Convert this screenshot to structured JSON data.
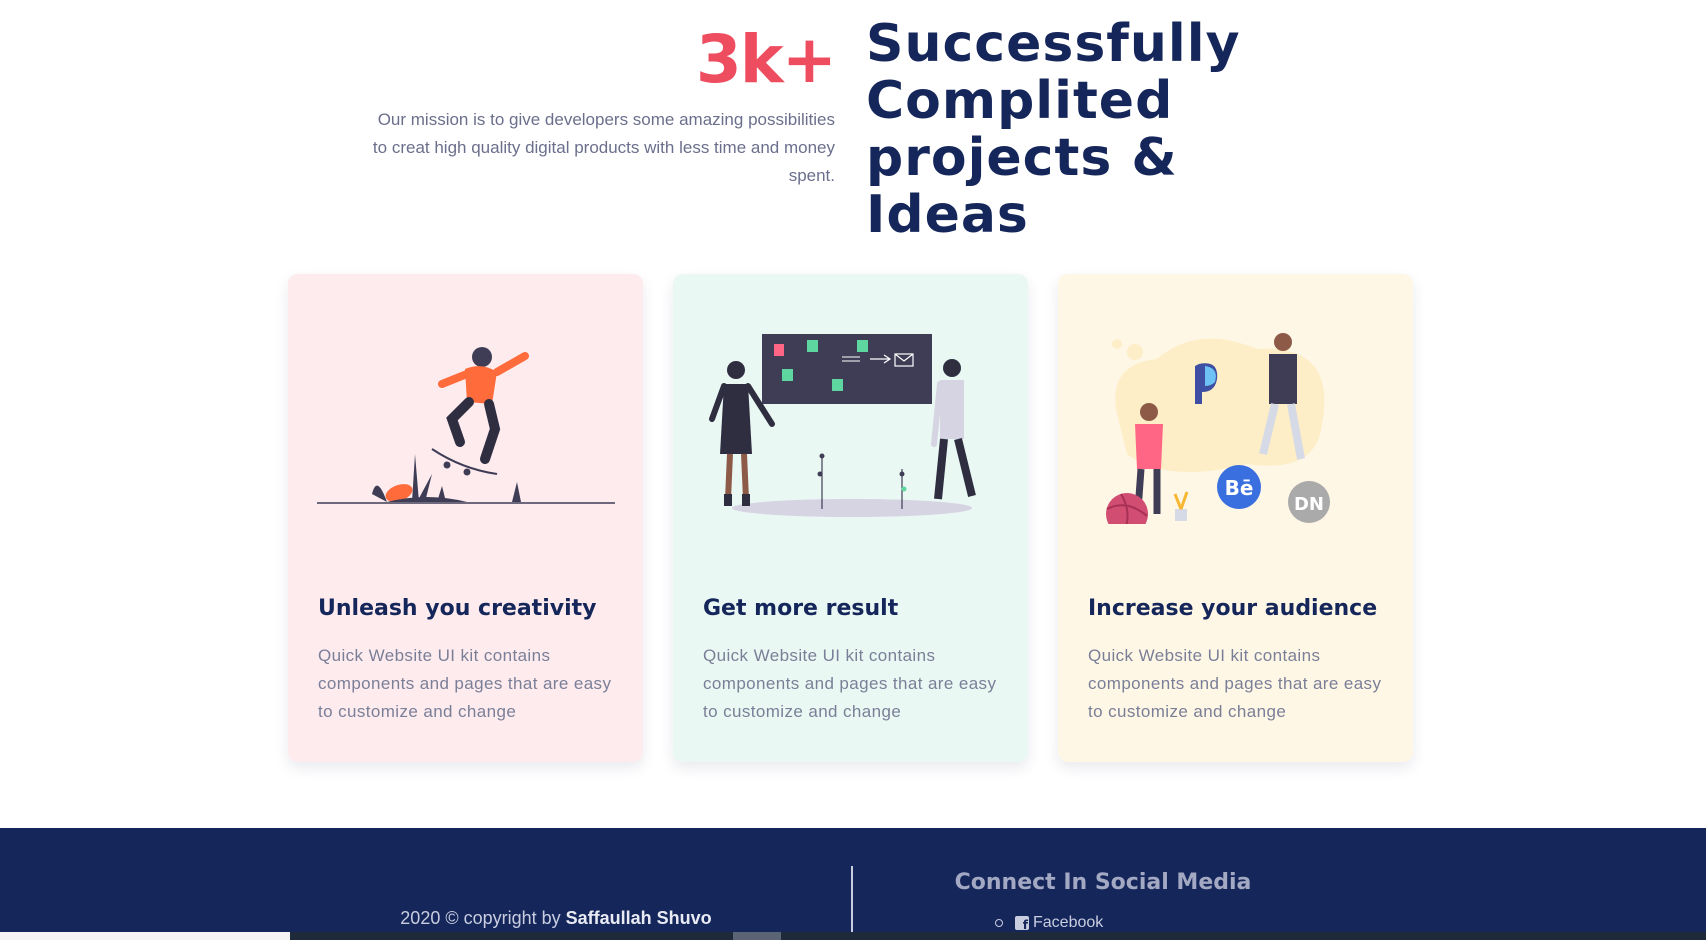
{
  "stats": {
    "number": "3k+",
    "mission": "Our mission is to give developers some amazing possibilities to creat high quality digital products with less time and money spent.",
    "heading_lines": [
      "Successfully",
      "Complited",
      "projects & Ideas"
    ]
  },
  "cards": [
    {
      "title": "Unleash you creativity",
      "text": "Quick Website UI kit contains components and pages that are easy to customize and change",
      "background": "#fdebee"
    },
    {
      "title": "Get more result",
      "text": "Quick Website UI kit contains components and pages that are easy to customize and change",
      "background": "#eaf8f3"
    },
    {
      "title": "Increase your audience",
      "text": "Quick Website UI kit contains components and pages that are easy to customize and change",
      "background": "#fff7e6"
    }
  ],
  "footer": {
    "copyright_prefix": "2020 © copyright by ",
    "copyright_author": "Saffaullah Shuvo",
    "social_title": "Connect In Social Media",
    "social_links": [
      {
        "label": "Facebook",
        "icon": "facebook-icon"
      }
    ]
  },
  "colors": {
    "accent": "#ee4d5f",
    "navy": "#15265a",
    "muted_text": "#7a7f98"
  }
}
